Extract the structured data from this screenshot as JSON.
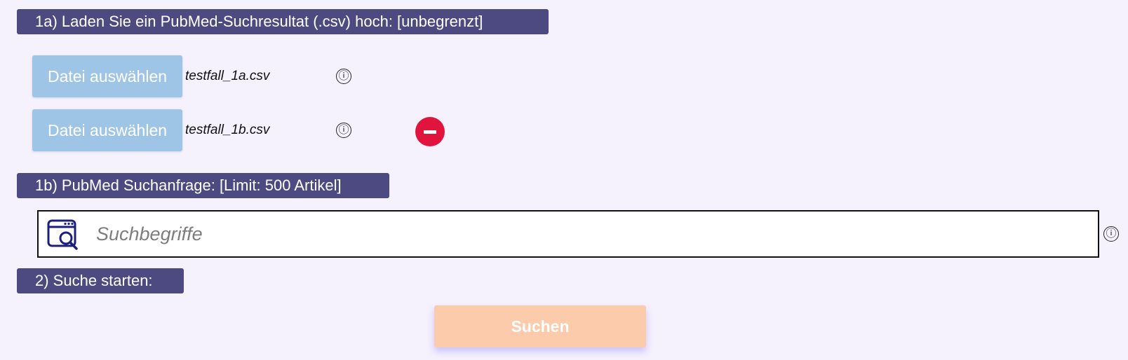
{
  "section_upload": {
    "title": "1a) Laden Sie ein PubMed-Suchresultat (.csv) hoch: [unbegrenzt]",
    "files": [
      {
        "button_label": "Datei auswählen",
        "file_name": "testfall_1a.csv",
        "info_icon": "ⓘ"
      },
      {
        "button_label": "Datei auswählen",
        "file_name": "testfall_1b.csv",
        "info_icon": "ⓘ"
      }
    ],
    "remove_icon": "minus-circle-icon"
  },
  "section_query": {
    "title": "1b) PubMed Suchanfrage: [Limit: 500 Artikel]",
    "placeholder": "Suchbegriffe",
    "value": "",
    "icon": "browser-search-icon",
    "info_icon": "ⓘ"
  },
  "section_start": {
    "title": "2) Suche starten:",
    "button_label": "Suchen"
  },
  "colors": {
    "header_bg": "#4d4a82",
    "file_button_bg": "#9fc5e6",
    "remove_button_bg": "#e0143c",
    "submit_button_bg": "#fbcbab",
    "page_bg": "#f5f1fd",
    "search_icon_color": "#1c1f80"
  }
}
